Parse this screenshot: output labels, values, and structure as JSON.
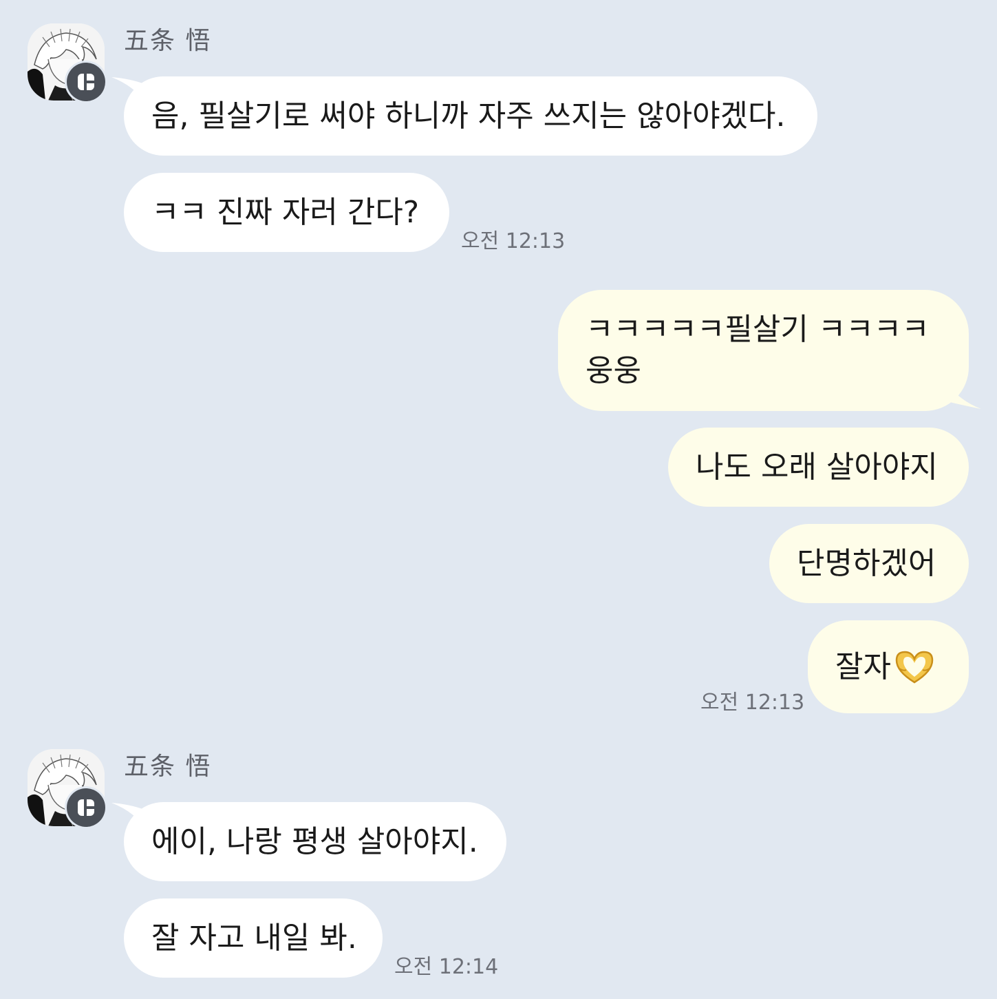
{
  "sender": "五条 悟",
  "messages_group_1": {
    "bubble_1": "음, 필살기로 써야 하니까 자주 쓰지는 않아야겠다.",
    "bubble_2": "ㅋㅋ 진짜 자러 간다?",
    "time": "오전 12:13"
  },
  "messages_me": {
    "bubble_1_line_1": "ㅋㅋㅋㅋㅋ필살기 ㅋㅋㅋㅋ",
    "bubble_1_line_2": "웅웅",
    "bubble_2": "나도 오래 살아야지",
    "bubble_3": "단명하겠어",
    "bubble_4": "잘자",
    "bubble_4_emoji": "heart-hands-icon",
    "time": "오전 12:13"
  },
  "messages_group_2": {
    "bubble_1": "에이, 나랑 평생 살아야지.",
    "bubble_2": "잘 자고 내일 봐.",
    "time": "오전 12:14"
  },
  "colors": {
    "background": "#e1e8f1",
    "incoming_bubble": "#ffffff",
    "outgoing_bubble": "#fefde9",
    "timestamp": "#6d7078",
    "sender_name": "#5d6068"
  }
}
